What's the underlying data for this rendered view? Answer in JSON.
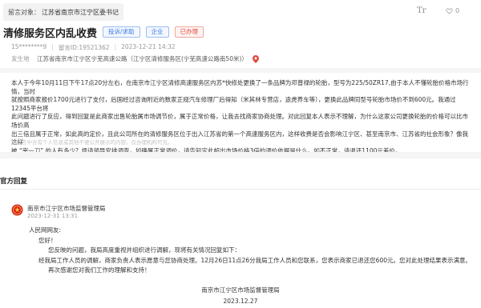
{
  "target": {
    "label": "留言对象：",
    "value": "江苏省南京市江宁区委书记"
  },
  "toolbar": {
    "font_size_label": "Tr",
    "like_count": "0"
  },
  "post": {
    "title": "清修服务区内乱收费",
    "tags": [
      {
        "label": "投诉/求助",
        "color": "#3d7be6"
      },
      {
        "label": "企业",
        "color": "#3d7be6"
      },
      {
        "label": "已办理",
        "color": "#e04a3f"
      }
    ],
    "author": "15********9",
    "date": "2023-12-21 14:32",
    "id_text": "留言ID:19521362",
    "place_label": "发生地",
    "place_value": "江苏省南京市江宁区宁芜高速公路（江宁区清修服务区(宁芜高速公路南50米)）",
    "content_lines": [
      "本人于今年10月11日下午17点20分左右，在南京市江宁区清修高速服务区内苏*快修处更换了一条品牌为邓普禄的轮胎，型号为225/50ZR17,由于本人不懂轮胎价格市场行情，当时",
      "就按照商家报价1700元进行了支付，后国经过咨询附近的数家正规汽车修理厂后得知（米其林专营店，途虎养车等），更换此品牌同型号轮胎市场价不到600元。我通过12345平台将",
      "此问题进行了反应，得到回复是此商家出售轮胎属市场调节价，属于正常价格，让我去找商家协商处理。对此回复本人表示不理解，为什么这家公司更换轮胎的价格可以比市场价高",
      "出三倍且属于正常，如此高的定价，且此公司所在的清修服务区位于出入江苏省的第一个高速服务区内，这样收费是否会影响江宁区、甚至南京市、江苏省的社会形象？像我这样",
      "被 “宰一刀” 的人有多少？烦请领导安排调查，如确属正常调价，请告知定此超出市场价格3倍的调价依据是什么。如不正常，请退还1100元差价。"
    ],
    "disclaimer": "该留言中含有个人信息或其他不便公开展示的内容，仅办理机构可见。"
  },
  "reply": {
    "section_title": "官方回复",
    "dept": "南京市江宁区市场监督管理局",
    "time": "2023-12-31 13:31",
    "greeting": "人民网网友:",
    "hello": "您好！",
    "paragraph1": "您反映的问题，我局高度重视并组织进行调解，现将有关情况回复如下：",
    "paragraph2": "经我局工作人员的调解，商家负责人表示愿意与您协商处理。12月26日11点26分我局工作人员和您联系，您表示商家已退还您600元。您对此处理结果表示满意。",
    "paragraph3": "再次感谢您对我们工作的理解和支持！",
    "sign_dept": "南京市江宁区市场监督管理局",
    "sign_date": "2023.12.27"
  }
}
